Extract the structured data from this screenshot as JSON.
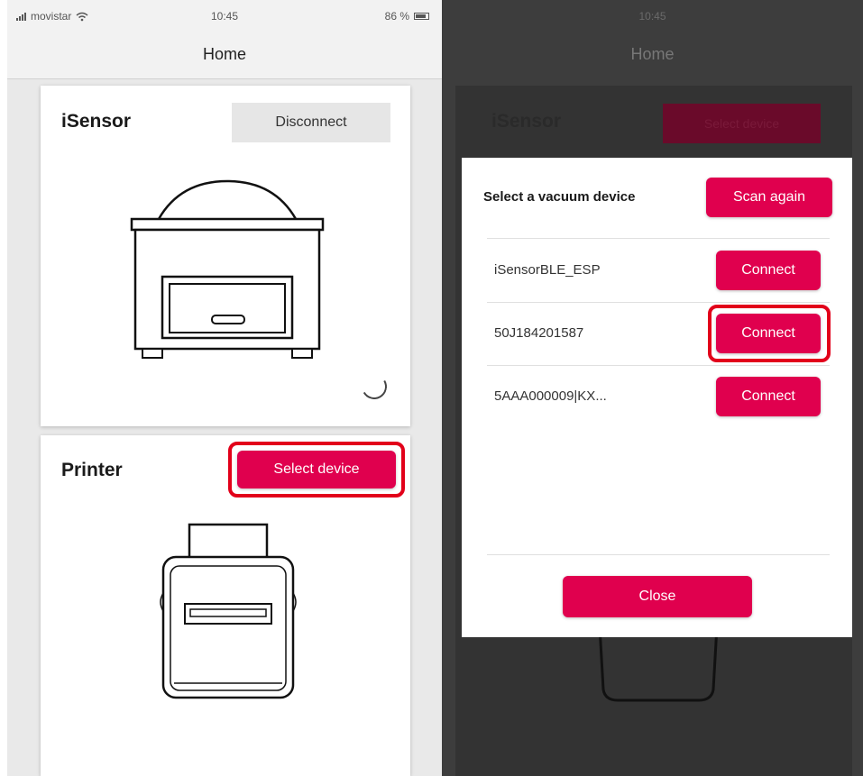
{
  "left_screen": {
    "status": {
      "carrier": "movistar",
      "time": "10:45",
      "battery": "86 %"
    },
    "nav_title": "Home",
    "isensor_card": {
      "title": "iSensor",
      "button_label": "Disconnect"
    },
    "printer_card": {
      "title": "Printer",
      "button_label": "Select device"
    }
  },
  "right_screen": {
    "status": {
      "time": "10:45"
    },
    "nav_title": "Home",
    "background_card": {
      "title": "iSensor",
      "button_label": "Select device"
    },
    "modal": {
      "header": "Select a vacuum device",
      "scan_again_label": "Scan again",
      "devices": [
        {
          "name": "iSensorBLE_ESP",
          "button_label": "Connect"
        },
        {
          "name": "50J184201587",
          "button_label": "Connect"
        },
        {
          "name": "5AAA000009|KX...",
          "button_label": "Connect"
        }
      ],
      "close_label": "Close"
    }
  },
  "colors": {
    "accent": "#e0004e",
    "highlight": "#e2001a",
    "overlay": "#3d3d3d"
  },
  "icons": {
    "signal": "signal-bars-icon",
    "wifi": "wifi-icon",
    "battery": "battery-icon",
    "spinner": "loading-spinner-icon"
  }
}
